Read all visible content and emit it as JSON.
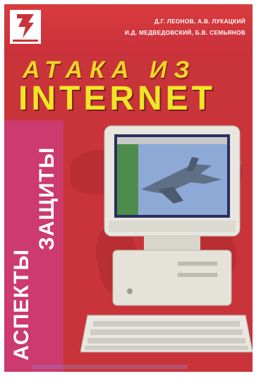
{
  "book": {
    "authors_line1": "Д.Г. ЛЕОНОВ, А.В. ЛУКАЦКИЙ",
    "authors_line2": "И.Д. МЕДВЕДОВСКИЙ, Б.В. СЕМЬЯНОВ",
    "title_top": "АТАКА ИЗ",
    "title_main": "INTERNET",
    "spine_word1": "АСПЕКТЫ",
    "spine_word2": "ЗАЩИТЫ"
  },
  "colors": {
    "background": "#c8343a",
    "title": "#f2d526",
    "stripe": "#cc3a6e",
    "watermark": "#3cc8e6"
  },
  "icons": [
    "publisher-logo-icon",
    "world-map-icon",
    "computer-illustration-icon",
    "jet-plane-icon"
  ]
}
